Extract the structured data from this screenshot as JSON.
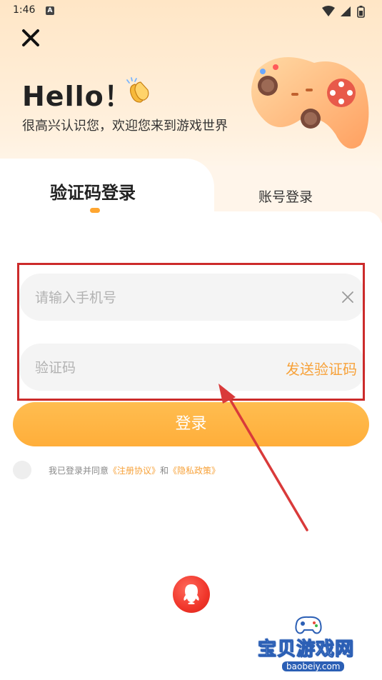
{
  "status_bar": {
    "time": "1:46",
    "notification_icon": "a-badge-icon",
    "icons": [
      "wifi-icon",
      "signal-icon",
      "battery-icon"
    ]
  },
  "header": {
    "close_icon": "close-icon",
    "greeting": "Hello！",
    "greeting_emoji": "clapping-hands-icon",
    "subtitle": "很高兴认识您，欢迎您来到游戏世界",
    "illustration": "gamepad-illustration"
  },
  "tabs": [
    {
      "label": "验证码登录",
      "active": true
    },
    {
      "label": "账号登录",
      "active": false
    }
  ],
  "form": {
    "phone": {
      "placeholder": "请输入手机号",
      "value": "",
      "clear_icon": "clear-icon"
    },
    "code": {
      "placeholder": "验证码",
      "value": "",
      "send_label": "发送验证码"
    },
    "login_label": "登录"
  },
  "agreement": {
    "prefix": "我已登录并同意",
    "link1": "《注册协议》",
    "conjunction": "和",
    "link2": "《隐私政策》"
  },
  "social": {
    "qq_icon": "qq-icon"
  },
  "watermark": {
    "title": "宝贝游戏网",
    "url": "baobeiy.com"
  },
  "colors": {
    "accent": "#ffae3a",
    "link": "#f7a23a",
    "annotation": "#cc2b2b",
    "qq": "#f0352a"
  }
}
